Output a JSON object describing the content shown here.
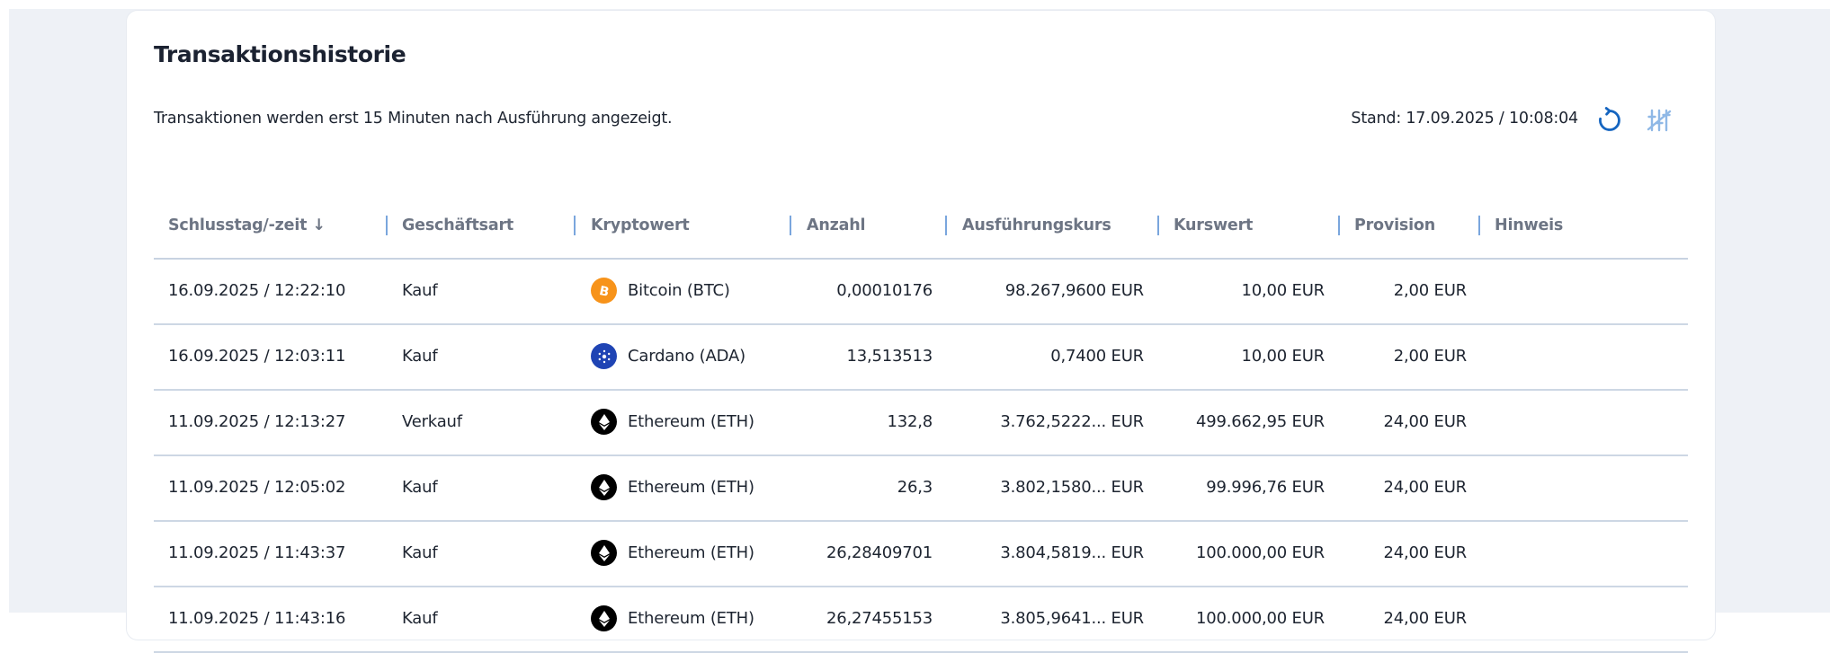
{
  "header": {
    "title": "Transaktionshistorie",
    "subtitle": "Transaktionen werden erst 15 Minuten nach Ausführung angezeigt.",
    "stand": "Stand: 17.09.2025 / 10:08:04",
    "refresh_icon": "refresh-icon",
    "settings_icon": "column-settings-icon"
  },
  "table": {
    "columns": [
      {
        "label": "Schlusstag/-zeit ↓"
      },
      {
        "label": "Geschäftsart"
      },
      {
        "label": "Kryptowert"
      },
      {
        "label": "Anzahl"
      },
      {
        "label": "Ausführungskurs"
      },
      {
        "label": "Kurswert"
      },
      {
        "label": "Provision"
      },
      {
        "label": "Hinweis"
      }
    ],
    "rows": [
      {
        "date": "16.09.2025 / 12:22:10",
        "type": "Kauf",
        "asset": "Bitcoin (BTC)",
        "icon": "bitcoin-icon",
        "icon_color": "#f7931a",
        "amount": "0,00010176",
        "price": "98.267,9600 EUR",
        "value": "10,00 EUR",
        "fee": "2,00 EUR",
        "note": ""
      },
      {
        "date": "16.09.2025 / 12:03:11",
        "type": "Kauf",
        "asset": "Cardano (ADA)",
        "icon": "cardano-icon",
        "icon_color": "#1f44b4",
        "amount": "13,513513",
        "price": "0,7400 EUR",
        "value": "10,00 EUR",
        "fee": "2,00 EUR",
        "note": ""
      },
      {
        "date": "11.09.2025 / 12:13:27",
        "type": "Verkauf",
        "asset": "Ethereum (ETH)",
        "icon": "ethereum-icon",
        "icon_color": "#000000",
        "amount": "132,8",
        "price": "3.762,5222... EUR",
        "value": "499.662,95 EUR",
        "fee": "24,00 EUR",
        "note": ""
      },
      {
        "date": "11.09.2025 / 12:05:02",
        "type": "Kauf",
        "asset": "Ethereum (ETH)",
        "icon": "ethereum-icon",
        "icon_color": "#000000",
        "amount": "26,3",
        "price": "3.802,1580... EUR",
        "value": "99.996,76 EUR",
        "fee": "24,00 EUR",
        "note": ""
      },
      {
        "date": "11.09.2025 / 11:43:37",
        "type": "Kauf",
        "asset": "Ethereum (ETH)",
        "icon": "ethereum-icon",
        "icon_color": "#000000",
        "amount": "26,28409701",
        "price": "3.804,5819... EUR",
        "value": "100.000,00 EUR",
        "fee": "24,00 EUR",
        "note": ""
      },
      {
        "date": "11.09.2025 / 11:43:16",
        "type": "Kauf",
        "asset": "Ethereum (ETH)",
        "icon": "ethereum-icon",
        "icon_color": "#000000",
        "amount": "26,27455153",
        "price": "3.805,9641... EUR",
        "value": "100.000,00 EUR",
        "fee": "24,00 EUR",
        "note": ""
      }
    ]
  },
  "colors": {
    "accent": "#1565c0",
    "header_text": "#6d7584",
    "separator": "#7aa6dd",
    "row_border": "#cdd7e4"
  }
}
